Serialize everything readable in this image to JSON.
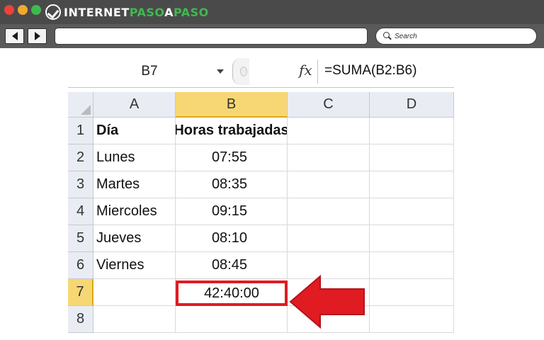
{
  "browser": {
    "logo": {
      "part1": "INTERNET",
      "part2": "PASO",
      "part3": "A",
      "part4": "PASO"
    },
    "search": {
      "placeholder": "Search"
    },
    "colors": {
      "chrome": "#4a4a4a",
      "accent": "#3fb950"
    }
  },
  "excel": {
    "name_box": "B7",
    "fx_label": "fx",
    "formula": "=SUMA(B2:B6)",
    "columns": [
      "A",
      "B",
      "C",
      "D"
    ],
    "rows": [
      {
        "num": "1",
        "a": "Día",
        "b": "Horas trabajadas"
      },
      {
        "num": "2",
        "a": "Lunes",
        "b": "07:55"
      },
      {
        "num": "3",
        "a": "Martes",
        "b": "08:35"
      },
      {
        "num": "4",
        "a": "Miercoles",
        "b": "09:15"
      },
      {
        "num": "5",
        "a": "Jueves",
        "b": "08:10"
      },
      {
        "num": "6",
        "a": "Viernes",
        "b": "08:45"
      },
      {
        "num": "7",
        "a": "",
        "b": "42:40:00"
      },
      {
        "num": "8",
        "a": "",
        "b": ""
      }
    ],
    "selected_cell": "B7",
    "colors": {
      "highlight": "#e01b22",
      "active_header": "#f7d774"
    }
  }
}
